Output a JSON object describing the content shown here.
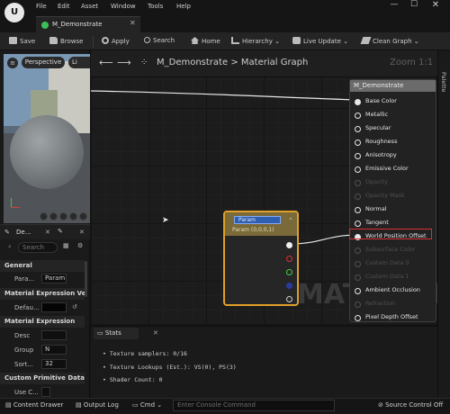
{
  "menu": [
    "File",
    "Edit",
    "Asset",
    "Window",
    "Tools",
    "Help"
  ],
  "tab": {
    "title": "M_Demonstrate"
  },
  "window_controls": {
    "minimize": "—",
    "maximize": "☐",
    "close": "✕"
  },
  "toolbar": {
    "save": "Save",
    "browse": "Browse",
    "apply": "Apply",
    "search": "Search",
    "home": "Home",
    "hierarchy": "Hierarchy",
    "live_update": "Live Update",
    "clean_graph": "Clean Graph"
  },
  "viewport": {
    "mode": "Perspective",
    "lit": "Li",
    "menu_glyph": "≡"
  },
  "details": {
    "tab": "De…",
    "search_placeholder": "Search",
    "sections": {
      "general": "General",
      "mat_expr_vector": "Material Expression Vecto",
      "default": "Defau...",
      "mat_expr": "Material Expression",
      "custom_primitive": "Custom Primitive Data"
    },
    "props": {
      "param_label": "Para...",
      "param_value": "Param",
      "desc_label": "Desc",
      "group_label": "Group",
      "group_value": "N",
      "sort_label": "Sort...",
      "sort_value": "32",
      "usec_label": "Use C..."
    }
  },
  "graph": {
    "breadcrumb_root": "M_Demonstrate",
    "breadcrumb_sep": ">",
    "breadcrumb_leaf": "Material Graph",
    "zoom": "Zoom 1:1",
    "watermark": "MATERIAL"
  },
  "param_node": {
    "name": "Param",
    "subtitle": "Param (0,0,0,1)"
  },
  "result_node": {
    "title": "M_Demonstrate",
    "pins": [
      {
        "label": "Base Color",
        "active": true,
        "connected": true
      },
      {
        "label": "Metallic",
        "active": true,
        "connected": false
      },
      {
        "label": "Specular",
        "active": true,
        "connected": false
      },
      {
        "label": "Roughness",
        "active": true,
        "connected": false
      },
      {
        "label": "Anisotropy",
        "active": true,
        "connected": false
      },
      {
        "label": "Emissive Color",
        "active": true,
        "connected": false
      },
      {
        "label": "Opacity",
        "active": false,
        "connected": false
      },
      {
        "label": "Opacity Mask",
        "active": false,
        "connected": false
      },
      {
        "label": "Normal",
        "active": true,
        "connected": false
      },
      {
        "label": "Tangent",
        "active": true,
        "connected": false
      },
      {
        "label": "World Position Offset",
        "active": true,
        "connected": true
      },
      {
        "label": "Subsurface Color",
        "active": false,
        "connected": false
      },
      {
        "label": "Custom Data 0",
        "active": false,
        "connected": false
      },
      {
        "label": "Custom Data 1",
        "active": false,
        "connected": false
      },
      {
        "label": "Ambient Occlusion",
        "active": true,
        "connected": false
      },
      {
        "label": "Refraction",
        "active": false,
        "connected": false
      },
      {
        "label": "Pixel Depth Offset",
        "active": true,
        "connected": false
      }
    ]
  },
  "palette": {
    "label": "Palette"
  },
  "stats": {
    "tab": "Stats",
    "lines": [
      "Texture samplers: 0/16",
      "Texture Lookups (Est.): VS(0), PS(3)",
      "Shader Count: 0"
    ]
  },
  "bottom": {
    "content_drawer": "Content Drawer",
    "output_log": "Output Log",
    "cmd": "Cmd",
    "console_placeholder": "Enter Console Command",
    "source_control": "Source Control Off"
  },
  "colors": {
    "param_border": "#e0a02a",
    "highlight": "#d83030",
    "accent_green": "#3cbe5a"
  }
}
